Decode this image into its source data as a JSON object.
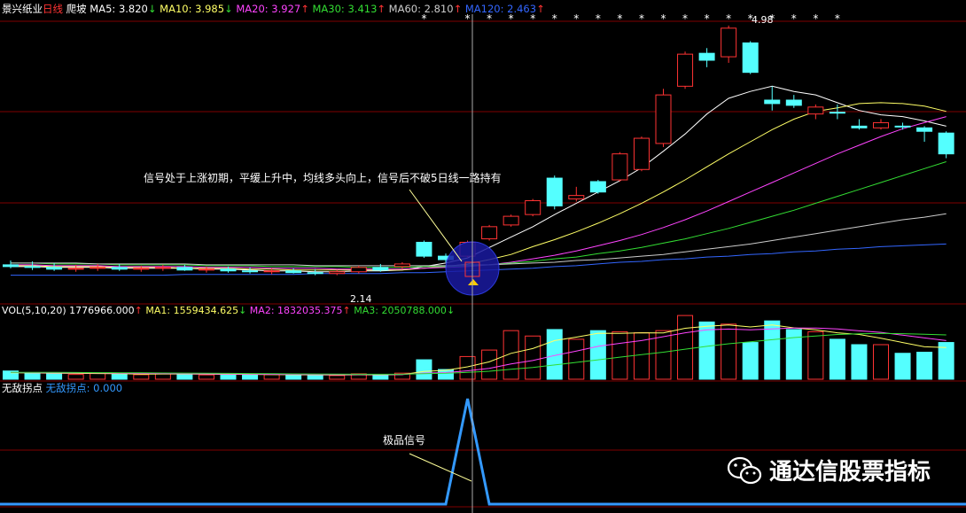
{
  "header": {
    "stock_name": "景兴纸业",
    "period": "日线",
    "pattern": "爬坡",
    "ma_items": [
      {
        "label": "MA5:",
        "value": "3.820",
        "arrow": "↓",
        "color": "#ffffff"
      },
      {
        "label": "MA10:",
        "value": "3.985",
        "arrow": "↓",
        "color": "#ffff66"
      },
      {
        "label": "MA20:",
        "value": "3.927",
        "arrow": "↑",
        "color": "#ff44ff"
      },
      {
        "label": "MA30:",
        "value": "3.413",
        "arrow": "↑",
        "color": "#33dd33"
      },
      {
        "label": "MA60:",
        "value": "2.810",
        "arrow": "↑",
        "color": "#cccccc"
      },
      {
        "label": "MA120:",
        "value": "2.463",
        "arrow": "↑",
        "color": "#3366ff"
      }
    ]
  },
  "price_panel": {
    "high_label": "4.98",
    "low_label": "2.14",
    "annotation": "信号处于上涨初期，平缓上升中，均线多头向上，信号后不破5日线一路持有"
  },
  "vol_panel": {
    "header_items": [
      {
        "label": "VOL(5,10,20)",
        "value": "1776966.000",
        "arrow": "↑",
        "color": "#ffffff"
      },
      {
        "label": "MA1:",
        "value": "1559434.625",
        "arrow": "↓",
        "color": "#ffff66"
      },
      {
        "label": "MA2:",
        "value": "1832035.375",
        "arrow": "↑",
        "color": "#ff44ff"
      },
      {
        "label": "MA3:",
        "value": "2050788.000",
        "arrow": "↓",
        "color": "#33dd33"
      }
    ]
  },
  "indicator_panel": {
    "name": "无敌拐点",
    "value_label": "无敌拐点:",
    "value": "0.000",
    "annotation": "极品信号"
  },
  "watermark": {
    "text": "通达信股票指标",
    "icon": "wechat-icon"
  },
  "colors": {
    "up": "#ff3333",
    "down": "#54ffff",
    "grid": "#800000",
    "signal": "#3399ff",
    "cursor": "#aaaaaa",
    "circle": "#1a1aa0"
  },
  "chart_data": [
    {
      "type": "candlestick",
      "title": "",
      "x_count": 44,
      "ylim": [
        1.8,
        5.05
      ],
      "candles": [
        {
          "o": 2.22,
          "h": 2.27,
          "l": 2.18,
          "c": 2.2
        },
        {
          "o": 2.2,
          "h": 2.26,
          "l": 2.16,
          "c": 2.19
        },
        {
          "o": 2.19,
          "h": 2.24,
          "l": 2.15,
          "c": 2.17
        },
        {
          "o": 2.17,
          "h": 2.22,
          "l": 2.14,
          "c": 2.18
        },
        {
          "o": 2.18,
          "h": 2.23,
          "l": 2.15,
          "c": 2.19
        },
        {
          "o": 2.19,
          "h": 2.23,
          "l": 2.15,
          "c": 2.17
        },
        {
          "o": 2.17,
          "h": 2.21,
          "l": 2.14,
          "c": 2.18
        },
        {
          "o": 2.18,
          "h": 2.22,
          "l": 2.15,
          "c": 2.19
        },
        {
          "o": 2.19,
          "h": 2.22,
          "l": 2.15,
          "c": 2.16
        },
        {
          "o": 2.16,
          "h": 2.2,
          "l": 2.13,
          "c": 2.17
        },
        {
          "o": 2.17,
          "h": 2.2,
          "l": 2.13,
          "c": 2.15
        },
        {
          "o": 2.15,
          "h": 2.19,
          "l": 2.12,
          "c": 2.14
        },
        {
          "o": 2.14,
          "h": 2.18,
          "l": 2.11,
          "c": 2.15
        },
        {
          "o": 2.15,
          "h": 2.18,
          "l": 2.12,
          "c": 2.13
        },
        {
          "o": 2.13,
          "h": 2.17,
          "l": 2.1,
          "c": 2.12
        },
        {
          "o": 2.12,
          "h": 2.16,
          "l": 2.1,
          "c": 2.14
        },
        {
          "o": 2.14,
          "h": 2.21,
          "l": 2.12,
          "c": 2.19
        },
        {
          "o": 2.19,
          "h": 2.23,
          "l": 2.14,
          "c": 2.16
        },
        {
          "o": 2.2,
          "h": 2.25,
          "l": 2.17,
          "c": 2.23
        },
        {
          "o": 2.48,
          "h": 2.5,
          "l": 2.3,
          "c": 2.32
        },
        {
          "o": 2.32,
          "h": 2.35,
          "l": 2.25,
          "c": 2.28
        },
        {
          "o": 2.32,
          "h": 2.5,
          "l": 2.3,
          "c": 2.48
        },
        {
          "o": 2.52,
          "h": 2.68,
          "l": 2.5,
          "c": 2.66
        },
        {
          "o": 2.68,
          "h": 2.8,
          "l": 2.66,
          "c": 2.78
        },
        {
          "o": 2.8,
          "h": 2.98,
          "l": 2.78,
          "c": 2.96
        },
        {
          "o": 3.22,
          "h": 3.25,
          "l": 2.86,
          "c": 2.9
        },
        {
          "o": 2.98,
          "h": 3.12,
          "l": 2.95,
          "c": 3.02
        },
        {
          "o": 3.18,
          "h": 3.2,
          "l": 3.04,
          "c": 3.06
        },
        {
          "o": 3.2,
          "h": 3.52,
          "l": 3.18,
          "c": 3.5
        },
        {
          "o": 3.32,
          "h": 3.7,
          "l": 3.3,
          "c": 3.68
        },
        {
          "o": 3.62,
          "h": 4.25,
          "l": 3.58,
          "c": 4.18
        },
        {
          "o": 4.28,
          "h": 4.68,
          "l": 4.25,
          "c": 4.65
        },
        {
          "o": 4.66,
          "h": 4.72,
          "l": 4.5,
          "c": 4.58
        },
        {
          "o": 4.62,
          "h": 4.98,
          "l": 4.55,
          "c": 4.95
        },
        {
          "o": 4.78,
          "h": 4.8,
          "l": 4.42,
          "c": 4.44
        },
        {
          "o": 4.12,
          "h": 4.28,
          "l": 4.0,
          "c": 4.08
        },
        {
          "o": 4.12,
          "h": 4.18,
          "l": 4.03,
          "c": 4.06
        },
        {
          "o": 3.96,
          "h": 4.07,
          "l": 3.9,
          "c": 4.04
        },
        {
          "o": 3.98,
          "h": 4.07,
          "l": 3.9,
          "c": 3.97
        },
        {
          "o": 3.82,
          "h": 3.9,
          "l": 3.78,
          "c": 3.8
        },
        {
          "o": 3.8,
          "h": 3.9,
          "l": 3.78,
          "c": 3.86
        },
        {
          "o": 3.82,
          "h": 3.86,
          "l": 3.78,
          "c": 3.81
        },
        {
          "o": 3.8,
          "h": 3.82,
          "l": 3.64,
          "c": 3.76
        },
        {
          "o": 3.74,
          "h": 3.76,
          "l": 3.45,
          "c": 3.5
        }
      ],
      "series": [
        {
          "name": "MA5",
          "color": "#ffffff",
          "values": [
            2.2,
            2.2,
            2.19,
            2.19,
            2.19,
            2.18,
            2.18,
            2.18,
            2.18,
            2.17,
            2.17,
            2.16,
            2.15,
            2.15,
            2.14,
            2.14,
            2.15,
            2.15,
            2.16,
            2.2,
            2.24,
            2.3,
            2.42,
            2.54,
            2.66,
            2.8,
            2.93,
            3.06,
            3.19,
            3.34,
            3.53,
            3.73,
            3.96,
            4.14,
            4.22,
            4.28,
            4.22,
            4.18,
            4.09,
            4.0,
            3.95,
            3.93,
            3.88,
            3.82
          ]
        },
        {
          "name": "MA10",
          "color": "#ffff66",
          "values": [
            2.21,
            2.21,
            2.2,
            2.2,
            2.2,
            2.19,
            2.19,
            2.19,
            2.18,
            2.18,
            2.18,
            2.17,
            2.17,
            2.16,
            2.16,
            2.16,
            2.16,
            2.16,
            2.16,
            2.18,
            2.2,
            2.23,
            2.28,
            2.34,
            2.43,
            2.51,
            2.6,
            2.7,
            2.81,
            2.93,
            3.06,
            3.2,
            3.35,
            3.5,
            3.64,
            3.78,
            3.9,
            3.99,
            4.03,
            4.08,
            4.09,
            4.08,
            4.05,
            3.99
          ]
        },
        {
          "name": "MA20",
          "color": "#ff44ff",
          "values": [
            2.22,
            2.22,
            2.21,
            2.21,
            2.21,
            2.2,
            2.2,
            2.2,
            2.2,
            2.19,
            2.19,
            2.19,
            2.18,
            2.18,
            2.18,
            2.17,
            2.17,
            2.17,
            2.17,
            2.18,
            2.19,
            2.2,
            2.22,
            2.25,
            2.29,
            2.33,
            2.38,
            2.44,
            2.5,
            2.57,
            2.65,
            2.74,
            2.84,
            2.95,
            3.06,
            3.17,
            3.28,
            3.39,
            3.5,
            3.6,
            3.7,
            3.79,
            3.86,
            3.93
          ]
        },
        {
          "name": "MA30",
          "color": "#33dd33",
          "values": [
            2.24,
            2.24,
            2.23,
            2.23,
            2.23,
            2.22,
            2.22,
            2.22,
            2.22,
            2.21,
            2.21,
            2.21,
            2.2,
            2.2,
            2.2,
            2.2,
            2.19,
            2.19,
            2.19,
            2.2,
            2.2,
            2.21,
            2.22,
            2.24,
            2.26,
            2.29,
            2.31,
            2.35,
            2.38,
            2.42,
            2.47,
            2.52,
            2.58,
            2.64,
            2.71,
            2.78,
            2.85,
            2.93,
            3.01,
            3.09,
            3.17,
            3.25,
            3.33,
            3.41
          ]
        },
        {
          "name": "MA60",
          "color": "#cccccc",
          "values": [
            2.24,
            2.24,
            2.24,
            2.24,
            2.23,
            2.23,
            2.23,
            2.23,
            2.23,
            2.22,
            2.22,
            2.22,
            2.22,
            2.22,
            2.21,
            2.21,
            2.21,
            2.21,
            2.21,
            2.21,
            2.21,
            2.22,
            2.22,
            2.23,
            2.24,
            2.25,
            2.27,
            2.28,
            2.3,
            2.32,
            2.34,
            2.37,
            2.4,
            2.43,
            2.46,
            2.5,
            2.54,
            2.58,
            2.62,
            2.66,
            2.7,
            2.74,
            2.77,
            2.81
          ]
        },
        {
          "name": "MA120",
          "color": "#3366ff",
          "values": [
            2.1,
            2.1,
            2.1,
            2.1,
            2.1,
            2.1,
            2.1,
            2.1,
            2.11,
            2.11,
            2.11,
            2.11,
            2.11,
            2.11,
            2.12,
            2.12,
            2.12,
            2.12,
            2.13,
            2.13,
            2.14,
            2.15,
            2.16,
            2.17,
            2.18,
            2.2,
            2.21,
            2.23,
            2.25,
            2.26,
            2.28,
            2.29,
            2.31,
            2.32,
            2.34,
            2.35,
            2.37,
            2.38,
            2.4,
            2.41,
            2.43,
            2.44,
            2.45,
            2.46
          ]
        }
      ],
      "star_markers": [
        19,
        21,
        22,
        23,
        24,
        25,
        26,
        27,
        28,
        29,
        30,
        31,
        32,
        33,
        34,
        35,
        36,
        37,
        38
      ]
    },
    {
      "type": "bar",
      "title": "VOL(5,10,20)",
      "ylim": [
        0,
        3200000
      ],
      "values": [
        380000,
        300000,
        250000,
        220000,
        270000,
        240000,
        210000,
        260000,
        230000,
        200000,
        220000,
        190000,
        210000,
        180000,
        200000,
        170000,
        250000,
        190000,
        280000,
        900000,
        450000,
        1050000,
        1350000,
        2250000,
        2000000,
        2300000,
        1850000,
        2250000,
        2200000,
        2150000,
        2250000,
        2950000,
        2650000,
        2550000,
        1700000,
        2700000,
        2300000,
        2200000,
        1850000,
        1600000,
        1600000,
        1200000,
        1250000,
        1700000
      ],
      "series": [
        {
          "name": "MA1",
          "color": "#ffff66",
          "values": [
            300000,
            290000,
            280000,
            270000,
            264000,
            256000,
            238000,
            240000,
            242000,
            228000,
            224000,
            220000,
            214000,
            204000,
            200000,
            194000,
            206000,
            202000,
            218000,
            362000,
            414000,
            574000,
            806000,
            1200000,
            1420000,
            1790000,
            1950000,
            2130000,
            2120000,
            2150000,
            2140000,
            2360000,
            2450000,
            2510000,
            2420000,
            2510000,
            2380000,
            2290000,
            2150000,
            2070000,
            1900000,
            1700000,
            1500000,
            1470000
          ]
        },
        {
          "name": "MA2",
          "color": "#ff44ff",
          "values": [
            310000,
            305000,
            300000,
            295000,
            290000,
            280000,
            270000,
            262000,
            256000,
            246000,
            244000,
            238000,
            227000,
            222000,
            214000,
            211000,
            212000,
            212000,
            216000,
            282000,
            309000,
            388000,
            506000,
            707000,
            864000,
            1100000,
            1300000,
            1520000,
            1660000,
            1790000,
            1970000,
            2150000,
            2290000,
            2320000,
            2290000,
            2330000,
            2370000,
            2370000,
            2330000,
            2240000,
            2170000,
            2040000,
            1910000,
            1790000
          ]
        },
        {
          "name": "MA3",
          "color": "#33dd33",
          "values": [
            320000,
            318000,
            315000,
            310000,
            305000,
            300000,
            295000,
            288000,
            283000,
            277000,
            270000,
            262000,
            254000,
            245000,
            240000,
            234000,
            230000,
            228000,
            228000,
            256000,
            275000,
            318000,
            370000,
            462000,
            545000,
            660000,
            780000,
            900000,
            1020000,
            1140000,
            1250000,
            1390000,
            1520000,
            1640000,
            1730000,
            1830000,
            1930000,
            2000000,
            2070000,
            2100000,
            2120000,
            2110000,
            2080000,
            2050000
          ]
        }
      ]
    },
    {
      "type": "line",
      "title": "无敌拐点",
      "ylim": [
        0,
        1.05
      ],
      "values": [
        0,
        0,
        0,
        0,
        0,
        0,
        0,
        0,
        0,
        0,
        0,
        0,
        0,
        0,
        0,
        0,
        0,
        0,
        0,
        0,
        0,
        1,
        0,
        0,
        0,
        0,
        0,
        0,
        0,
        0,
        0,
        0,
        0,
        0,
        0,
        0,
        0,
        0,
        0,
        0,
        0,
        0,
        0,
        0
      ]
    }
  ]
}
